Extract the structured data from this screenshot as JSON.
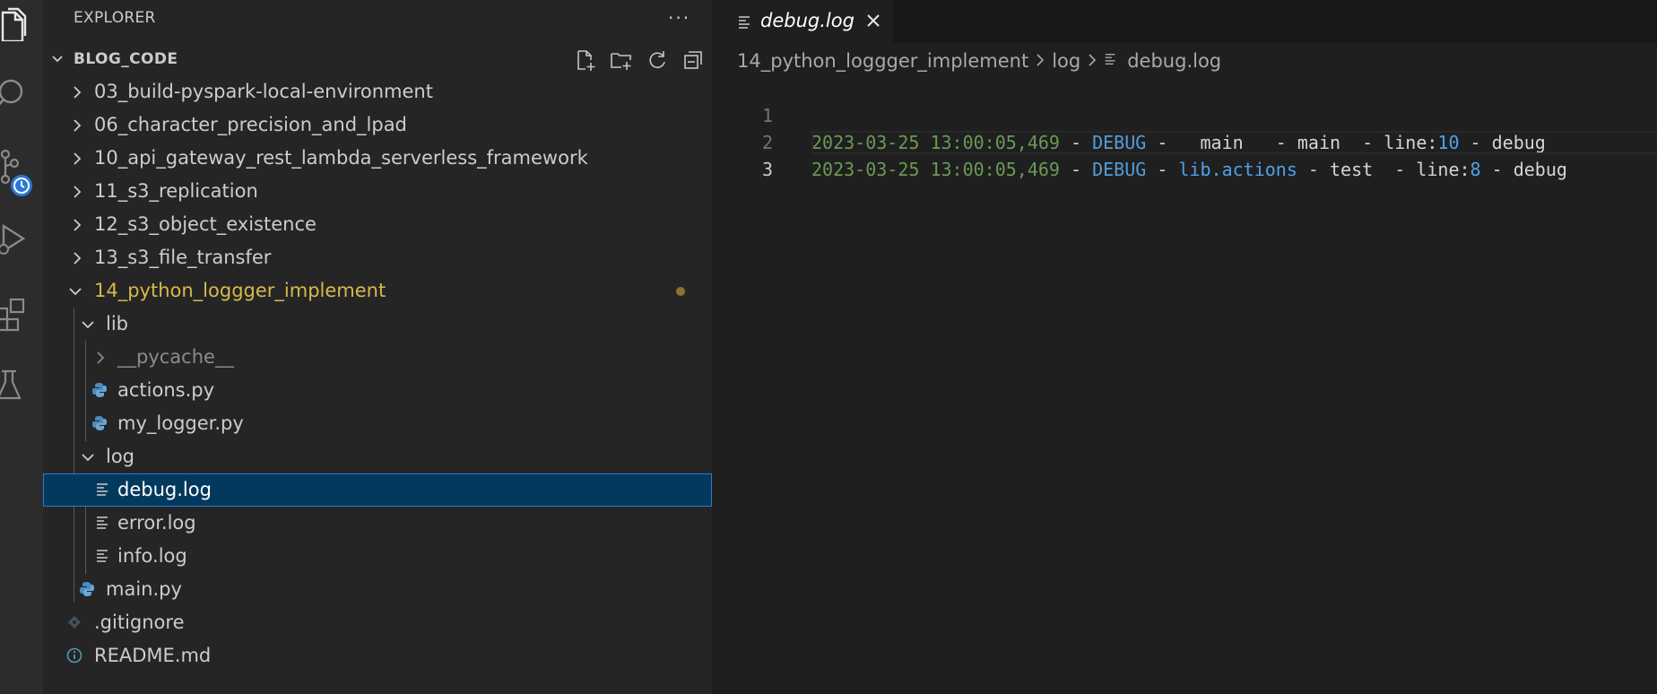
{
  "app": {
    "accent_color": "#2b79d9",
    "modified_color": "#d7ba49"
  },
  "activity_bar": {
    "icons": [
      "files-icon",
      "search-icon",
      "source-control-icon",
      "run-debug-icon",
      "extensions-icon",
      "testing-icon"
    ]
  },
  "explorer": {
    "header": "EXPLORER",
    "more_label": "···",
    "section_title": "BLOG_CODE",
    "section_actions": [
      "new-file-icon",
      "new-folder-icon",
      "refresh-icon",
      "collapse-all-icon"
    ],
    "items": [
      {
        "label": "03_build-pyspark-local-environment",
        "type": "folder",
        "expanded": false
      },
      {
        "label": "06_character_precision_and_lpad",
        "type": "folder",
        "expanded": false
      },
      {
        "label": "10_api_gateway_rest_lambda_serverless_framework",
        "type": "folder",
        "expanded": false
      },
      {
        "label": "11_s3_replication",
        "type": "folder",
        "expanded": false
      },
      {
        "label": "12_s3_object_existence",
        "type": "folder",
        "expanded": false
      },
      {
        "label": "13_s3_file_transfer",
        "type": "folder",
        "expanded": false
      },
      {
        "label": "14_python_loggger_implement",
        "type": "folder",
        "expanded": true,
        "modified": true
      },
      {
        "label": "lib",
        "type": "folder",
        "expanded": true
      },
      {
        "label": "__pycache__",
        "type": "folder",
        "expanded": false
      },
      {
        "label": "actions.py",
        "type": "python"
      },
      {
        "label": "my_logger.py",
        "type": "python"
      },
      {
        "label": "log",
        "type": "folder",
        "expanded": true
      },
      {
        "label": "debug.log",
        "type": "text",
        "selected": true
      },
      {
        "label": "error.log",
        "type": "text"
      },
      {
        "label": "info.log",
        "type": "text"
      },
      {
        "label": "main.py",
        "type": "python"
      },
      {
        "label": ".gitignore",
        "type": "git"
      },
      {
        "label": "README.md",
        "type": "info"
      }
    ]
  },
  "editor": {
    "tab": {
      "label": "debug.log",
      "close_icon": "close-icon"
    },
    "breadcrumb": [
      "14_python_loggger_implement",
      "log",
      "debug.log"
    ],
    "lines": [
      {
        "number": "1",
        "parts": [
          {
            "text": "2023-03-25 13:00:05,469",
            "c": "green"
          },
          {
            "text": " - ",
            "c": "white"
          },
          {
            "text": "DEBUG",
            "c": "blue"
          },
          {
            "text": " - __main__ - main  - line:",
            "c": "white"
          },
          {
            "text": "10",
            "c": "cyan"
          },
          {
            "text": " - debug",
            "c": "white"
          }
        ]
      },
      {
        "number": "2",
        "parts": [
          {
            "text": "2023-03-25 13:00:05,469",
            "c": "green"
          },
          {
            "text": " - ",
            "c": "white"
          },
          {
            "text": "DEBUG",
            "c": "blue"
          },
          {
            "text": " - ",
            "c": "white"
          },
          {
            "text": "lib.actions",
            "c": "cyan"
          },
          {
            "text": " - test  - line:",
            "c": "white"
          },
          {
            "text": "8",
            "c": "cyan"
          },
          {
            "text": " - debug",
            "c": "white"
          }
        ]
      },
      {
        "number": "3",
        "parts": []
      }
    ]
  }
}
